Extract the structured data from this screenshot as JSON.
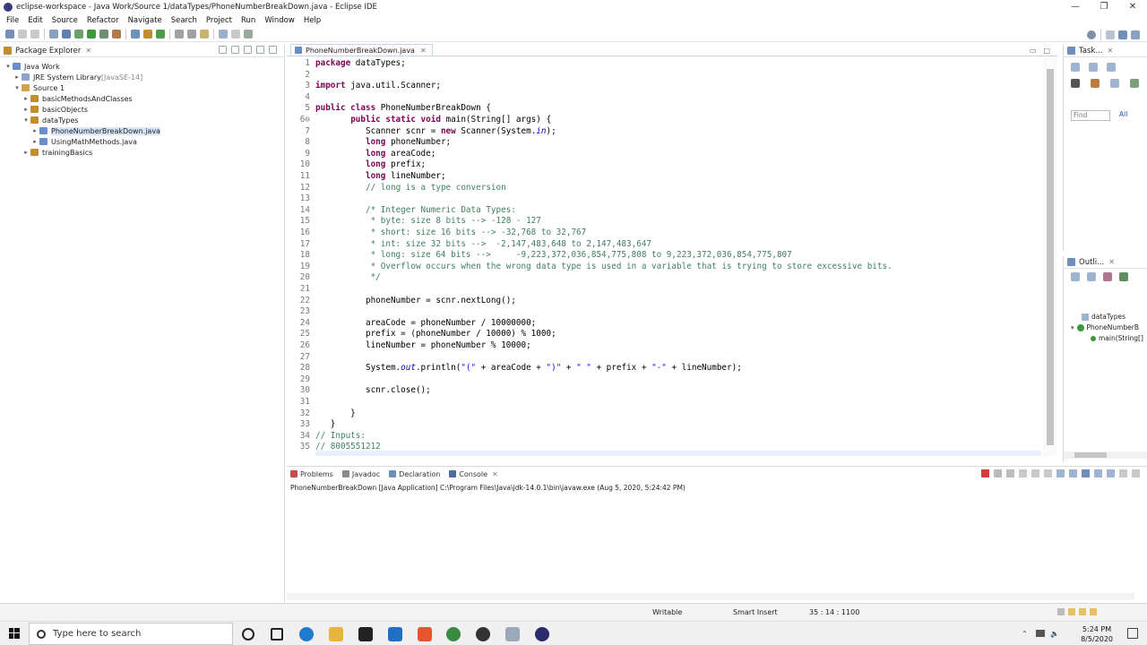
{
  "window": {
    "title": "eclipse-workspace - Java Work/Source 1/dataTypes/PhoneNumberBreakDown.java - Eclipse IDE",
    "controls": [
      "—",
      "❐",
      "✕"
    ]
  },
  "menu": [
    "File",
    "Edit",
    "Source",
    "Refactor",
    "Navigate",
    "Search",
    "Project",
    "Run",
    "Window",
    "Help"
  ],
  "package_explorer": {
    "title": "Package Explorer",
    "items": [
      {
        "label": "Java Work",
        "depth": 0,
        "arrow": "▾",
        "icon_color": "#6a8ec9"
      },
      {
        "label": "JRE System Library",
        "suffix": "[JavaSE-14]",
        "depth": 1,
        "arrow": "▸",
        "icon_color": "#8fa1c8"
      },
      {
        "label": "Source 1",
        "depth": 1,
        "arrow": "▾",
        "icon_color": "#d4a14a"
      },
      {
        "label": "basicMethodsAndClasses",
        "depth": 2,
        "arrow": "▸",
        "icon_color": "#c28d2f"
      },
      {
        "label": "basicObjects",
        "depth": 2,
        "arrow": "▸",
        "icon_color": "#c28d2f"
      },
      {
        "label": "dataTypes",
        "depth": 2,
        "arrow": "▾",
        "icon_color": "#c28d2f"
      },
      {
        "label": "PhoneNumberBreakDown.java",
        "depth": 3,
        "arrow": "▸",
        "icon_color": "#6a8ec9",
        "selected": true
      },
      {
        "label": "UsingMathMethods.java",
        "depth": 3,
        "arrow": "▸",
        "icon_color": "#6a8ec9"
      },
      {
        "label": "trainingBasics",
        "depth": 2,
        "arrow": "▸",
        "icon_color": "#c28d2f"
      }
    ]
  },
  "editor": {
    "tab_label": "PhoneNumberBreakDown.java",
    "tab_close": "✕",
    "lines": [
      {
        "n": "1",
        "html": "<span class=\"kw\">package</span> dataTypes;"
      },
      {
        "n": "2",
        "html": ""
      },
      {
        "n": "3",
        "html": "<span class=\"kw\">import</span> java.util.Scanner;"
      },
      {
        "n": "4",
        "html": ""
      },
      {
        "n": "5",
        "html": "<span class=\"kw\">public class</span> PhoneNumberBreakDown {"
      },
      {
        "n": "6⊖",
        "html": "       <span class=\"kw\">public static void</span> main(String[] args) {"
      },
      {
        "n": "7",
        "html": "          Scanner scnr = <span class=\"kw\">new</span> Scanner(System.<span class=\"fld\">in</span>);"
      },
      {
        "n": "8",
        "html": "          <span class=\"kw\">long</span> phoneNumber;"
      },
      {
        "n": "9",
        "html": "          <span class=\"kw\">long</span> areaCode;"
      },
      {
        "n": "10",
        "html": "          <span class=\"kw\">long</span> prefix;"
      },
      {
        "n": "11",
        "html": "          <span class=\"kw\">long</span> lineNumber;"
      },
      {
        "n": "12",
        "html": "          <span class=\"cm\">// long is a type conversion</span>"
      },
      {
        "n": "13",
        "html": ""
      },
      {
        "n": "14",
        "html": "          <span class=\"cm\">/* Integer Numeric Data Types:</span>"
      },
      {
        "n": "15",
        "html": "<span class=\"cm\">           * byte: size 8 bits --&gt; -128 - 127</span>"
      },
      {
        "n": "16",
        "html": "<span class=\"cm\">           * short: size 16 bits --&gt; -32,768 to 32,767</span>"
      },
      {
        "n": "17",
        "html": "<span class=\"cm\">           * int: size 32 bits --&gt;  -2,147,483,648 to 2,147,483,647</span>"
      },
      {
        "n": "18",
        "html": "<span class=\"cm\">           * long: size 64 bits --&gt;     -9,223,372,036,854,775,808 to 9,223,372,036,854,775,807</span>"
      },
      {
        "n": "19",
        "html": "<span class=\"cm\">           * Overflow occurs when the wrong data type is used in a variable that is trying to store excessive bits.</span>"
      },
      {
        "n": "20",
        "html": "<span class=\"cm\">           */</span>"
      },
      {
        "n": "21",
        "html": ""
      },
      {
        "n": "22",
        "html": "          phoneNumber = scnr.nextLong();"
      },
      {
        "n": "23",
        "html": ""
      },
      {
        "n": "24",
        "html": "          areaCode = phoneNumber / 10000000;"
      },
      {
        "n": "25",
        "html": "          prefix = (phoneNumber / 10000) % 1000;"
      },
      {
        "n": "26",
        "html": "          lineNumber = phoneNumber % 10000;"
      },
      {
        "n": "27",
        "html": ""
      },
      {
        "n": "28",
        "html": "          System.<span class=\"fld\">out</span>.println(<span class=\"str\">\"(\"</span> + areaCode + <span class=\"str\">\")\"</span> + <span class=\"str\">\" \"</span> + prefix + <span class=\"str\">\"-\"</span> + lineNumber);"
      },
      {
        "n": "29",
        "html": ""
      },
      {
        "n": "30",
        "html": "          scnr.close();"
      },
      {
        "n": "31",
        "html": ""
      },
      {
        "n": "32",
        "html": "       }"
      },
      {
        "n": "33",
        "html": "   }"
      },
      {
        "n": "34",
        "html": "<span class=\"cm\">// Inputs:</span>"
      },
      {
        "n": "35",
        "html": "<span class=\"cm\">// 8005551212</span>"
      }
    ]
  },
  "task_view": {
    "title": "Task...",
    "find_placeholder": "Find",
    "all_label": "All"
  },
  "outline_view": {
    "title": "Outli...",
    "items": [
      "dataTypes",
      "PhoneNumberB",
      "main(String[]"
    ]
  },
  "console": {
    "tabs": [
      "Problems",
      "Javadoc",
      "Declaration",
      "Console"
    ],
    "description": "PhoneNumberBreakDown [Java Application] C:\\Program Files\\Java\\jdk-14.0.1\\bin\\javaw.exe (Aug 5, 2020, 5:24:42 PM)"
  },
  "status": {
    "writable": "Writable",
    "insert_mode": "Smart Insert",
    "position": "35 : 14 : 1100"
  },
  "taskbar": {
    "search_placeholder": "Type here to search",
    "time": "5:24 PM",
    "date": "8/5/2020"
  },
  "colors": {
    "accent": "#3c78d8",
    "keyword": "#7f0055",
    "comment": "#3f7f5f",
    "string": "#2a00ff"
  }
}
